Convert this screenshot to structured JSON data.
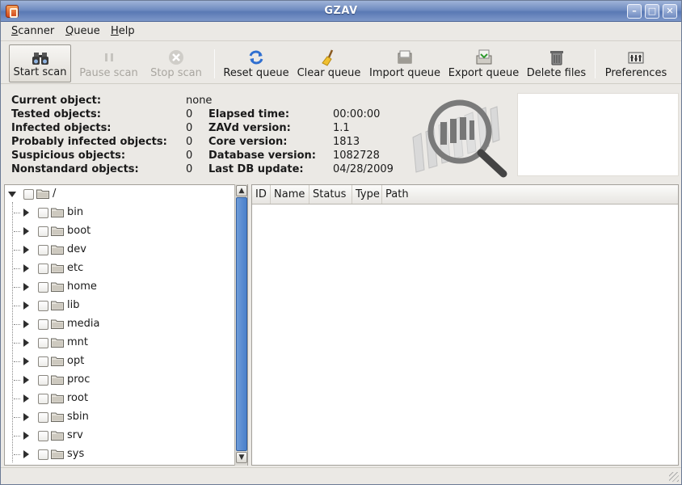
{
  "window": {
    "title": "GZAV"
  },
  "menu": [
    {
      "prefix": "",
      "u": "S",
      "rest": "canner"
    },
    {
      "prefix": "",
      "u": "Q",
      "rest": "ueue"
    },
    {
      "prefix": "",
      "u": "H",
      "rest": "elp"
    }
  ],
  "toolbar": {
    "start_scan": "Start scan",
    "pause_scan": "Pause scan",
    "stop_scan": "Stop scan",
    "reset_queue": "Reset queue",
    "clear_queue": "Clear queue",
    "import_queue": "Import queue",
    "export_queue": "Export queue",
    "delete_files": "Delete files",
    "preferences": "Preferences"
  },
  "stats": {
    "current_object_label": "Current object:",
    "current_object_value": "none",
    "tested_label": "Tested objects:",
    "tested_value": "0",
    "infected_label": "Infected objects:",
    "infected_value": "0",
    "prob_infected_label": "Probably infected objects:",
    "prob_infected_value": "0",
    "suspicious_label": "Suspicious objects:",
    "suspicious_value": "0",
    "nonstandard_label": "Nonstandard objects:",
    "nonstandard_value": "0",
    "elapsed_label": "Elapsed time:",
    "elapsed_value": "00:00:00",
    "zavd_label": "ZAVd version:",
    "zavd_value": "1.1",
    "core_label": "Core version:",
    "core_value": "1813",
    "db_label": "Database version:",
    "db_value": "1082728",
    "lastdb_label": "Last DB update:",
    "lastdb_value": "04/28/2009"
  },
  "tree": {
    "root": "/",
    "items": [
      "bin",
      "boot",
      "dev",
      "etc",
      "home",
      "lib",
      "media",
      "mnt",
      "opt",
      "proc",
      "root",
      "sbin",
      "srv",
      "sys"
    ]
  },
  "list": {
    "columns": [
      "ID",
      "Name",
      "Status",
      "Type",
      "Path"
    ]
  }
}
